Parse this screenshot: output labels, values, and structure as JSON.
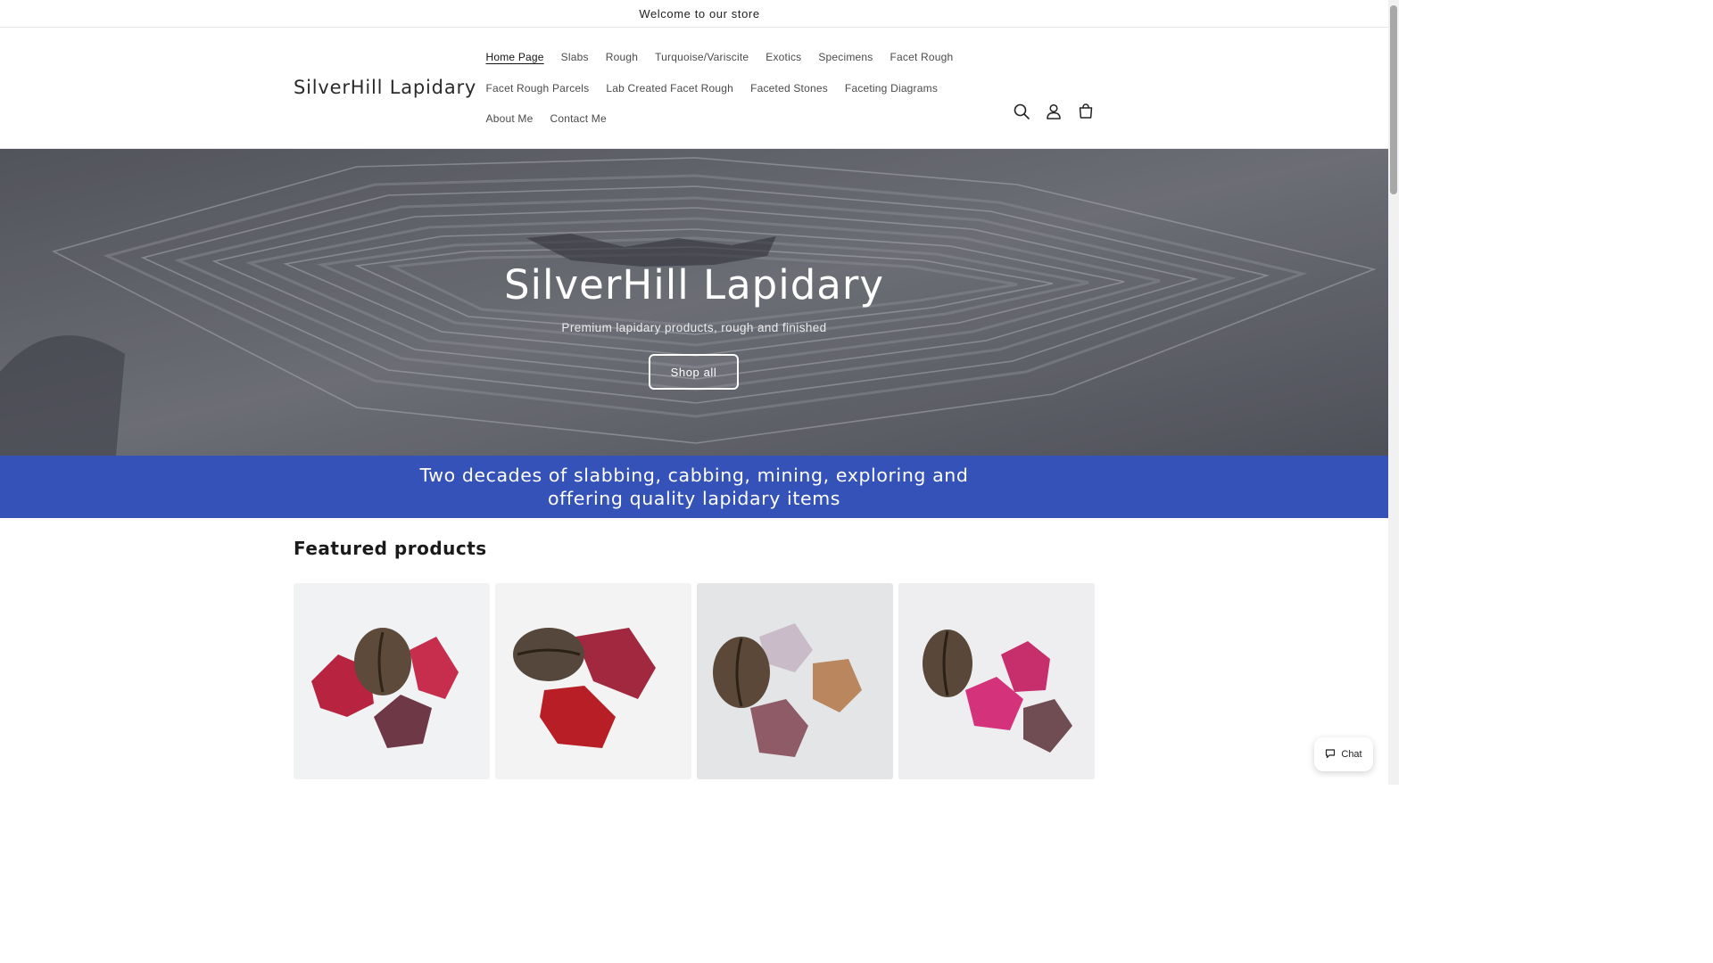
{
  "announcement": {
    "text": "Welcome to our store"
  },
  "header": {
    "logo": "SilverHill Lapidary",
    "nav": [
      {
        "label": "Home Page",
        "active": true
      },
      {
        "label": "Slabs"
      },
      {
        "label": "Rough"
      },
      {
        "label": "Turquoise/Variscite"
      },
      {
        "label": "Exotics"
      },
      {
        "label": "Specimens"
      },
      {
        "label": "Facet Rough"
      },
      {
        "label": "Facet Rough Parcels"
      },
      {
        "label": "Lab Created Facet Rough"
      },
      {
        "label": "Faceted Stones"
      },
      {
        "label": "Faceting Diagrams"
      },
      {
        "label": "About Me"
      },
      {
        "label": "Contact Me"
      }
    ],
    "icons": [
      "search-icon",
      "account-icon",
      "cart-icon"
    ]
  },
  "hero": {
    "title": "SilverHill Lapidary",
    "subtitle": "Premium lapidary products, rough and finished",
    "button": "Shop all"
  },
  "banner": {
    "text": "Two decades of slabbing, cabbing, mining, exploring and offering quality lapidary items"
  },
  "featured": {
    "title": "Featured products",
    "products": [
      {
        "image": "garnet rough with coffee bean (red)"
      },
      {
        "image": "garnet rough with coffee bean (deep red)"
      },
      {
        "image": "mixed pink/peach rough with coffee bean"
      },
      {
        "image": "pink rough with coffee bean"
      }
    ]
  },
  "chat": {
    "label": "Chat"
  },
  "colors": {
    "banner": "#3452b7",
    "hero_overlay": "#6e7079",
    "text": "#121212"
  }
}
